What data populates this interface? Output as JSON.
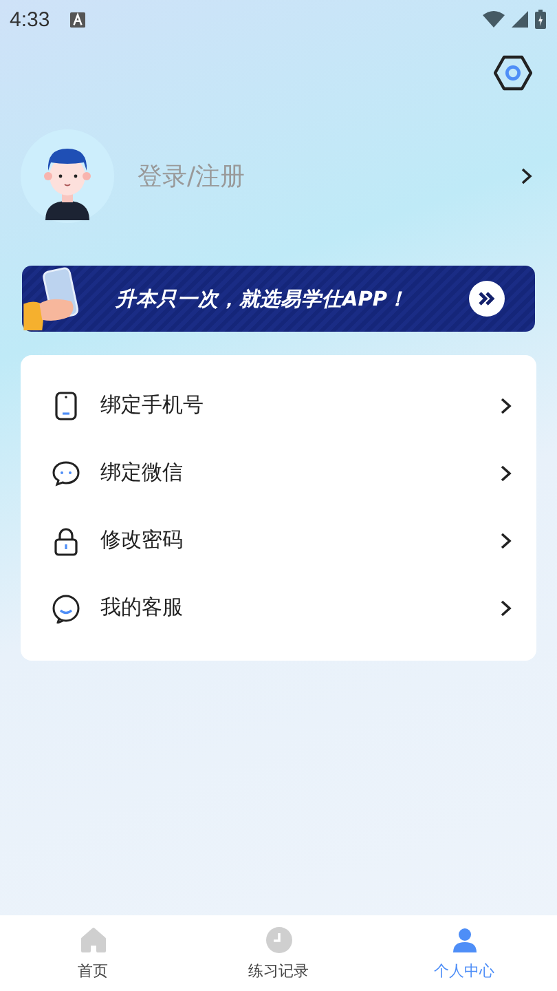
{
  "status_bar": {
    "time": "4:33"
  },
  "profile": {
    "login_label": "登录/注册"
  },
  "banner": {
    "text": "升本只一次，就选易学仕APP！"
  },
  "menu": [
    {
      "kind": "phone",
      "label": "绑定手机号"
    },
    {
      "kind": "chat",
      "label": "绑定微信"
    },
    {
      "kind": "lock",
      "label": "修改密码"
    },
    {
      "kind": "service",
      "label": "我的客服"
    }
  ],
  "bottom_nav": [
    {
      "kind": "home",
      "label": "首页",
      "selected": false
    },
    {
      "kind": "clock",
      "label": "练习记录",
      "selected": false
    },
    {
      "kind": "person",
      "label": "个人中心",
      "selected": true
    }
  ]
}
